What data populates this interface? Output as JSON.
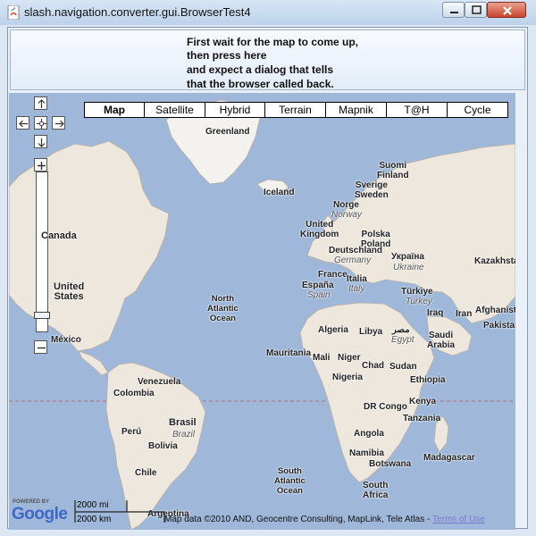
{
  "window": {
    "title": "slash.navigation.converter.gui.BrowserTest4",
    "controls": {
      "minimize": "minimize-icon",
      "maximize": "maximize-icon",
      "close": "close-icon"
    }
  },
  "message_button": {
    "lines": [
      "First wait for the map to come up,",
      "then press here",
      "and expect a dialog that tells",
      "that the browser called back."
    ]
  },
  "map": {
    "map_types": [
      "Map",
      "Satellite",
      "Hybrid",
      "Terrain",
      "Mapnik",
      "T@H",
      "Cycle"
    ],
    "selected_map_type": "Map",
    "labels": {
      "greenland": "Greenland",
      "iceland": "Iceland",
      "finland": "Suomi\nFinland",
      "sweden": "Sverige\nSweden",
      "norway_local": "Norge",
      "norway": "Norway",
      "uk": "United\nKingdom",
      "poland": "Polska\nPoland",
      "germany_local": "Deutschland",
      "germany": "Germany",
      "ukraine_local": "Україна",
      "ukraine": "Ukraine",
      "kazakhstan": "Kazakhsta",
      "france": "France",
      "spain_local": "España",
      "spain": "Spain",
      "italy_local": "Italia",
      "italy": "Italy",
      "turkey_local": "Türkiye",
      "turkey": "Turkey",
      "afghanistan": "Afghanista",
      "iraq": "Iraq",
      "iran": "Iran",
      "pakistan": "Pakistan",
      "canada": "Canada",
      "usa": "United\nStates",
      "mexico": "México",
      "north_atlantic": "North\nAtlantic\nOcean",
      "algeria": "Algeria",
      "libya": "Libya",
      "egypt_local": "مصر",
      "egypt": "Egypt",
      "saudi": "Saudi\nArabia",
      "mauritania": "Mauritania",
      "mali": "Mali",
      "niger": "Niger",
      "chad": "Chad",
      "sudan": "Sudan",
      "nigeria": "Nigeria",
      "ethiopia": "Ethiopia",
      "venezuela": "Venezuela",
      "colombia": "Colombia",
      "kenya": "Kenya",
      "drcongo": "DR Congo",
      "tanzania": "Tanzania",
      "brasil": "Brasil",
      "brazil": "Brazil",
      "peru": "Perú",
      "bolivia": "Bolivia",
      "angola": "Angola",
      "namibia": "Namibia",
      "botswana": "Botswana",
      "madagascar": "Madagascar",
      "chile": "Chile",
      "south_atlantic": "South\nAtlantic\nOcean",
      "south_africa": "South\nAfrica",
      "argentina": "Argentina"
    },
    "powered_by": "POWERED BY",
    "google": "Google",
    "scale_mi": "2000 mi",
    "scale_km": "2000 km",
    "attribution": "Map data ©2010 AND, Geocentre Consulting, MapLink, Tele Atlas - ",
    "terms": "Terms of Use"
  }
}
